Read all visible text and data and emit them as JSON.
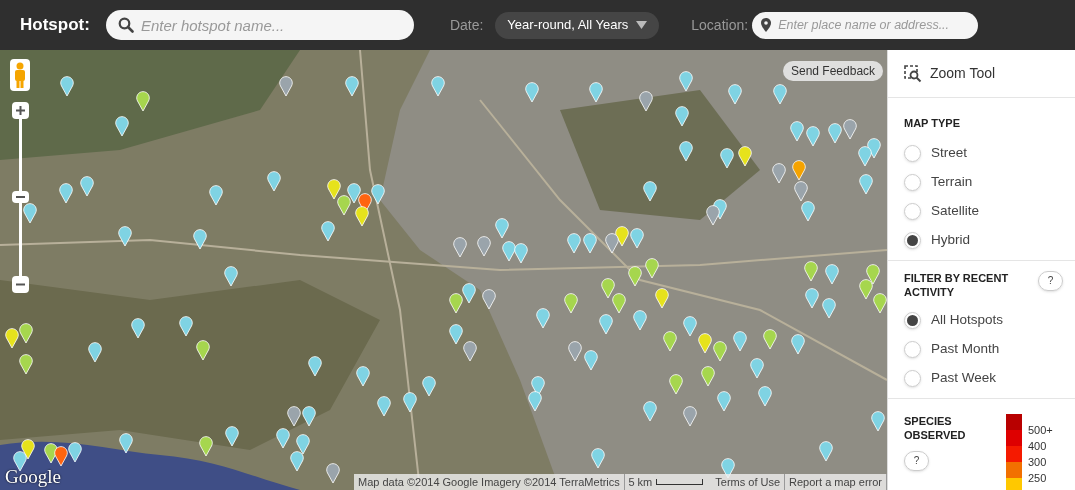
{
  "header": {
    "title": "Hotspot:",
    "search": {
      "placeholder": "Enter hotspot name..."
    },
    "date": {
      "label": "Date:",
      "value": "Year-round, All Years"
    },
    "location": {
      "label": "Location:",
      "placeholder": "Enter place name or address..."
    }
  },
  "map": {
    "send_feedback": "Send Feedback",
    "logo": "Google",
    "attribution": "Map data ©2014 Google Imagery ©2014 TerraMetrics",
    "scale": "5 km",
    "links": [
      "Terms of Use",
      "Report a map error"
    ],
    "pins": [
      {
        "color": "#7fd3e3"
      },
      {
        "color": "#a6d64e"
      },
      {
        "color": "#9aa4ab"
      },
      {
        "color": "#7fd3e3"
      },
      {
        "color": "#7fd3e3"
      },
      {
        "color": "#7fd3e3"
      },
      {
        "color": "#7fd3e3"
      },
      {
        "color": "#7fd3e3"
      },
      {
        "color": "#9aa4ab"
      },
      {
        "color": "#7fd3e3"
      },
      {
        "color": "#7fd3e3"
      },
      {
        "color": "#7fd3e3"
      },
      {
        "color": "#7fd3e3"
      },
      {
        "color": "#7fd3e3"
      },
      {
        "color": "#7fd3e3"
      },
      {
        "color": "#7fd3e3"
      },
      {
        "color": "#9aa4ab"
      },
      {
        "color": "#7fd3e3"
      },
      {
        "color": "#7fd3e3"
      },
      {
        "color": "#7fd3e3"
      },
      {
        "color": "#e6e21c"
      },
      {
        "color": "#9aa4ab"
      },
      {
        "color": "#f5a300"
      },
      {
        "color": "#7fd3e3"
      },
      {
        "color": "#7fd3e3"
      },
      {
        "color": "#9aa4ab"
      },
      {
        "color": "#7fd3e3"
      },
      {
        "color": "#7fd3e3"
      },
      {
        "color": "#9aa4ab"
      },
      {
        "color": "#7fd3e3"
      },
      {
        "color": "#e6e21c"
      },
      {
        "color": "#9aa4ab"
      },
      {
        "color": "#7fd3e3"
      },
      {
        "color": "#7fd3e3"
      },
      {
        "color": "#7fd3e3"
      },
      {
        "color": "#9aa4ab"
      },
      {
        "color": "#9aa4ab"
      },
      {
        "color": "#7fd3e3"
      },
      {
        "color": "#7fd3e3"
      },
      {
        "color": "#7fd3e3"
      },
      {
        "color": "#e6e21c"
      },
      {
        "color": "#7fd3e3"
      },
      {
        "color": "#7fd3e3"
      },
      {
        "color": "#ff6410"
      },
      {
        "color": "#a6d64e"
      },
      {
        "color": "#e6e21c"
      },
      {
        "color": "#7fd3e3"
      },
      {
        "color": "#7fd3e3"
      },
      {
        "color": "#7fd3e3"
      },
      {
        "color": "#7fd3e3"
      },
      {
        "color": "#7fd3e3"
      },
      {
        "color": "#7fd3e3"
      },
      {
        "color": "#7fd3e3"
      },
      {
        "color": "#7fd3e3"
      },
      {
        "color": "#7fd3e3"
      },
      {
        "color": "#7fd3e3"
      },
      {
        "color": "#7fd3e3"
      },
      {
        "color": "#a6d64e"
      },
      {
        "color": "#7fd3e3"
      },
      {
        "color": "#e6e21c"
      },
      {
        "color": "#a6d64e"
      },
      {
        "color": "#a6d64e"
      },
      {
        "color": "#a6d64e"
      },
      {
        "color": "#7fd3e3"
      },
      {
        "color": "#9aa4ab"
      },
      {
        "color": "#7fd3e3"
      },
      {
        "color": "#a6d64e"
      },
      {
        "color": "#a6d64e"
      },
      {
        "color": "#a6d64e"
      },
      {
        "color": "#a6d64e"
      },
      {
        "color": "#e6e21c"
      },
      {
        "color": "#a6d64e"
      },
      {
        "color": "#7fd3e3"
      },
      {
        "color": "#7fd3e3"
      },
      {
        "color": "#a6d64e"
      },
      {
        "color": "#7fd3e3"
      },
      {
        "color": "#e6e21c"
      },
      {
        "color": "#a6d64e"
      },
      {
        "color": "#7fd3e3"
      },
      {
        "color": "#a6d64e"
      },
      {
        "color": "#7fd3e3"
      },
      {
        "color": "#7fd3e3"
      },
      {
        "color": "#a6d64e"
      },
      {
        "color": "#a6d64e"
      },
      {
        "color": "#7fd3e3"
      },
      {
        "color": "#9aa4ab"
      },
      {
        "color": "#7fd3e3"
      },
      {
        "color": "#7fd3e3"
      },
      {
        "color": "#a6d64e"
      },
      {
        "color": "#7fd3e3"
      },
      {
        "color": "#a6d64e"
      },
      {
        "color": "#a6d64e"
      },
      {
        "color": "#a6d64e"
      },
      {
        "color": "#7fd3e3"
      },
      {
        "color": "#7fd3e3"
      },
      {
        "color": "#7fd3e3"
      },
      {
        "color": "#9aa4ab"
      },
      {
        "color": "#9aa4ab"
      },
      {
        "color": "#7fd3e3"
      },
      {
        "color": "#7fd3e3"
      },
      {
        "color": "#7fd3e3"
      },
      {
        "color": "#7fd3e3"
      },
      {
        "color": "#7fd3e3"
      },
      {
        "color": "#7fd3e3"
      },
      {
        "color": "#7fd3e3"
      },
      {
        "color": "#7fd3e3"
      },
      {
        "color": "#7fd3e3"
      },
      {
        "color": "#9aa4ab"
      },
      {
        "color": "#7fd3e3"
      },
      {
        "color": "#7fd3e3"
      },
      {
        "color": "#7fd3e3"
      },
      {
        "color": "#a6d64e"
      },
      {
        "color": "#7fd3e3"
      },
      {
        "color": "#e6e21c"
      },
      {
        "color": "#a6d64e"
      },
      {
        "color": "#ff6410"
      },
      {
        "color": "#7fd3e3"
      },
      {
        "color": "#7fd3e3"
      },
      {
        "color": "#7fd3e3"
      },
      {
        "color": "#9aa4ab"
      },
      {
        "color": "#7fd3e3"
      },
      {
        "color": "#7fd3e3"
      },
      {
        "color": "#7fd3e3"
      },
      {
        "color": "#7fd3e3"
      }
    ]
  },
  "sidebar": {
    "zoom_tool": "Zoom Tool",
    "map_type": {
      "title": "MAP TYPE",
      "options": [
        {
          "label": "Street",
          "selected": false
        },
        {
          "label": "Terrain",
          "selected": false
        },
        {
          "label": "Satellite",
          "selected": false
        },
        {
          "label": "Hybrid",
          "selected": true
        }
      ]
    },
    "filter": {
      "title": "FILTER BY RECENT ACTIVITY",
      "help": "?",
      "options": [
        {
          "label": "All Hotspots",
          "selected": true
        },
        {
          "label": "Past Month",
          "selected": false
        },
        {
          "label": "Past Week",
          "selected": false
        }
      ]
    },
    "species": {
      "title": "SPECIES OBSERVED",
      "help": "?",
      "legend": [
        {
          "color": "#b80000",
          "label": "500+"
        },
        {
          "color": "#de0000",
          "label": "400"
        },
        {
          "color": "#f51a00",
          "label": "300"
        },
        {
          "color": "#f27000",
          "label": "250"
        },
        {
          "color": "#ffc800"
        }
      ]
    }
  }
}
